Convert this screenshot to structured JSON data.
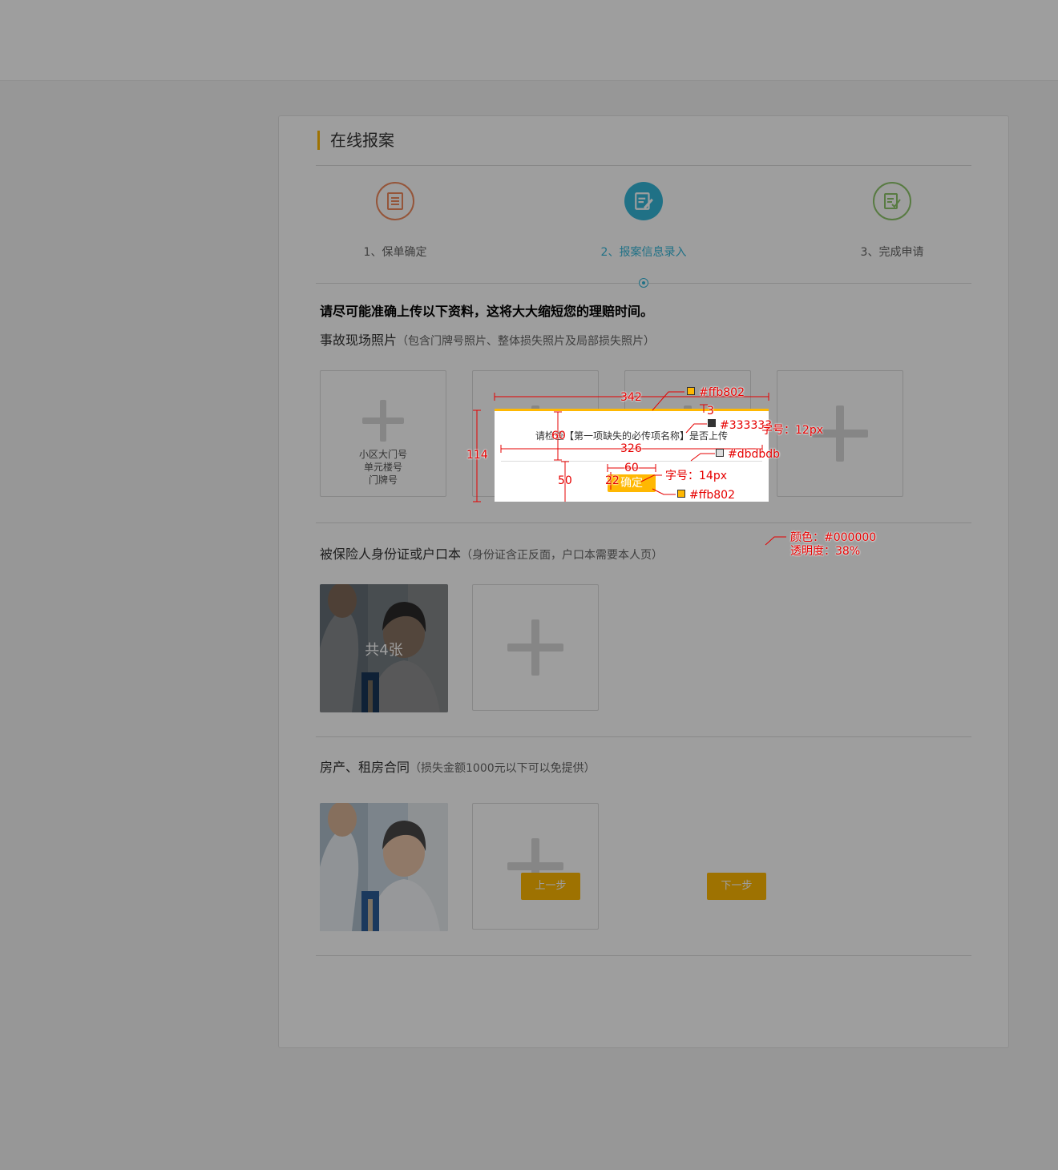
{
  "page": {
    "title": "在线报案",
    "steps": [
      {
        "label": "1、保单确定",
        "color": "#f08a5d"
      },
      {
        "label": "2、报案信息录入",
        "color": "#35b6d9"
      },
      {
        "label": "3、完成申请",
        "color": "#8fc76b"
      }
    ],
    "intro": "请尽可能准确上传以下资料，这将大大缩短您的理赔时间。"
  },
  "sections": {
    "scene": {
      "title": "事故现场照片",
      "hint": "（包含门牌号照片、整体损失照片及局部损失照片）",
      "slot1_lines": [
        "小区大门号",
        "单元楼号",
        "门牌号"
      ]
    },
    "id": {
      "title": "被保险人身份证或户口本",
      "hint": "（身份证含正反面，户口本需要本人页）",
      "photo_count": "共4张"
    },
    "contract": {
      "title": "房产、租房合同",
      "hint": "（损失金额1000元以下可以免提供）"
    }
  },
  "buttons": {
    "prev": "上一步",
    "next": "下一步"
  },
  "dialog": {
    "msg_pre": "请检查",
    "msg_item": "【第一项缺失的必传项名称】",
    "msg_post": "是否上传",
    "ok": "确定"
  },
  "annotations": {
    "w342": "342",
    "h3": "3",
    "h60": "60",
    "w326": "326",
    "h114": "114",
    "h50": "50",
    "w60": "60",
    "h22": "22",
    "c_top": "#ffb802",
    "c_text": "#333333",
    "c_line": "#dbdbdb",
    "c_btn": "#ffb802",
    "font12": "字号：12px",
    "font14": "字号：14px",
    "mask_color": "颜色：#000000",
    "mask_opacity": "透明度：38%"
  },
  "colors": {
    "accent": "#ffb802",
    "step_active": "#35b6d9"
  }
}
